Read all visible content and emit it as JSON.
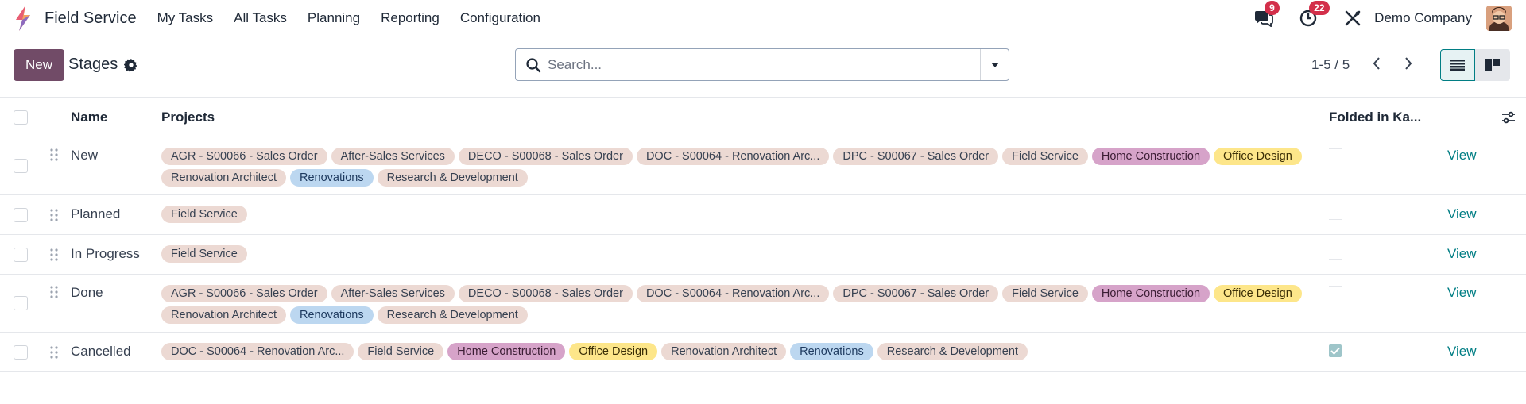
{
  "navbar": {
    "app_name": "Field Service",
    "menu": [
      "My Tasks",
      "All Tasks",
      "Planning",
      "Reporting",
      "Configuration"
    ],
    "messages_count": "9",
    "activities_count": "22",
    "company": "Demo Company"
  },
  "control": {
    "new_label": "New",
    "breadcrumb": "Stages",
    "search_placeholder": "Search...",
    "pager": "1-5 / 5"
  },
  "table": {
    "headers": {
      "name": "Name",
      "projects": "Projects",
      "folded": "Folded in Ka..."
    },
    "view_label": "View",
    "rows": [
      {
        "name": "New",
        "folded": false,
        "tags": [
          {
            "label": "AGR - S00066 - Sales Order",
            "color": "beige"
          },
          {
            "label": "After-Sales Services",
            "color": "beige"
          },
          {
            "label": "DECO - S00068 - Sales Order",
            "color": "beige"
          },
          {
            "label": "DOC - S00064 - Renovation Arc...",
            "color": "beige"
          },
          {
            "label": "DPC - S00067 - Sales Order",
            "color": "beige"
          },
          {
            "label": "Field Service",
            "color": "beige"
          },
          {
            "label": "Home Construction",
            "color": "pink"
          },
          {
            "label": "Office Design",
            "color": "yellow"
          },
          {
            "label": "Renovation Architect",
            "color": "beige"
          },
          {
            "label": "Renovations",
            "color": "blue"
          },
          {
            "label": "Research & Development",
            "color": "beige"
          }
        ]
      },
      {
        "name": "Planned",
        "folded": false,
        "tags": [
          {
            "label": "Field Service",
            "color": "beige"
          }
        ]
      },
      {
        "name": "In Progress",
        "folded": false,
        "tags": [
          {
            "label": "Field Service",
            "color": "beige"
          }
        ]
      },
      {
        "name": "Done",
        "folded": false,
        "tags": [
          {
            "label": "AGR - S00066 - Sales Order",
            "color": "beige"
          },
          {
            "label": "After-Sales Services",
            "color": "beige"
          },
          {
            "label": "DECO - S00068 - Sales Order",
            "color": "beige"
          },
          {
            "label": "DOC - S00064 - Renovation Arc...",
            "color": "beige"
          },
          {
            "label": "DPC - S00067 - Sales Order",
            "color": "beige"
          },
          {
            "label": "Field Service",
            "color": "beige"
          },
          {
            "label": "Home Construction",
            "color": "pink"
          },
          {
            "label": "Office Design",
            "color": "yellow"
          },
          {
            "label": "Renovation Architect",
            "color": "beige"
          },
          {
            "label": "Renovations",
            "color": "blue"
          },
          {
            "label": "Research & Development",
            "color": "beige"
          }
        ]
      },
      {
        "name": "Cancelled",
        "folded": true,
        "tags": [
          {
            "label": "DOC - S00064 - Renovation Arc...",
            "color": "beige"
          },
          {
            "label": "Field Service",
            "color": "beige"
          },
          {
            "label": "Home Construction",
            "color": "pink"
          },
          {
            "label": "Office Design",
            "color": "yellow"
          },
          {
            "label": "Renovation Architect",
            "color": "beige"
          },
          {
            "label": "Renovations",
            "color": "blue"
          },
          {
            "label": "Research & Development",
            "color": "beige"
          }
        ]
      }
    ]
  },
  "colors": {
    "brand": "#714b67",
    "accent": "#017e84",
    "badge": "#d32f4a"
  }
}
